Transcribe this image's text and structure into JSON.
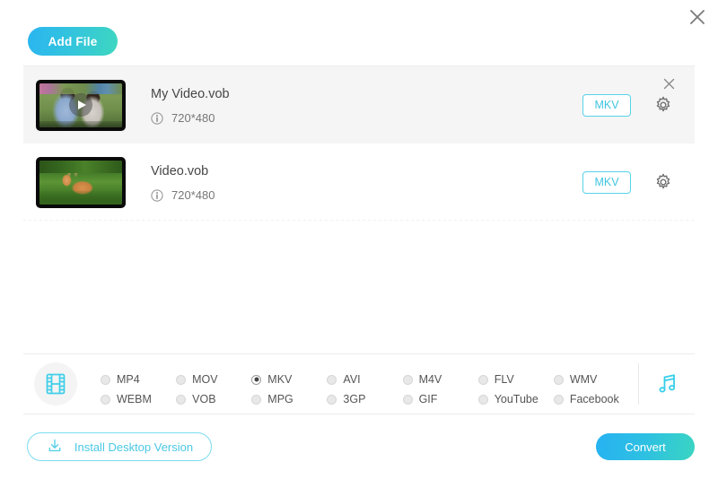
{
  "window": {
    "close_icon": "close-icon"
  },
  "toolbar": {
    "add_file_label": "Add File"
  },
  "files": [
    {
      "name": "My Video.vob",
      "resolution": "720*480",
      "format": "MKV",
      "selected": true,
      "has_play_overlay": true,
      "thumbnail": "two-people-on-grass",
      "info_icon": "info-icon",
      "settings_icon": "gear-icon",
      "remove_icon": "close-icon"
    },
    {
      "name": "Video.vob",
      "resolution": "720*480",
      "format": "MKV",
      "selected": false,
      "has_play_overlay": false,
      "thumbnail": "deer-in-grass",
      "info_icon": "info-icon",
      "settings_icon": "gear-icon"
    }
  ],
  "format_panel": {
    "video_icon": "film-strip-icon",
    "audio_icon": "music-note-icon",
    "selected_format": "MKV",
    "options": [
      {
        "label": "MP4",
        "checked": false
      },
      {
        "label": "MOV",
        "checked": false
      },
      {
        "label": "MKV",
        "checked": true
      },
      {
        "label": "AVI",
        "checked": false
      },
      {
        "label": "M4V",
        "checked": false
      },
      {
        "label": "FLV",
        "checked": false
      },
      {
        "label": "WMV",
        "checked": false
      },
      {
        "label": "WEBM",
        "checked": false
      },
      {
        "label": "VOB",
        "checked": false
      },
      {
        "label": "MPG",
        "checked": false
      },
      {
        "label": "3GP",
        "checked": false
      },
      {
        "label": "GIF",
        "checked": false
      },
      {
        "label": "YouTube",
        "checked": false
      },
      {
        "label": "Facebook",
        "checked": false
      }
    ]
  },
  "footer": {
    "install_label": "Install Desktop Version",
    "install_icon": "download-icon",
    "convert_label": "Convert"
  },
  "colors": {
    "accent_cyan": "#4ac8e4",
    "gradient_start": "#26b2f2",
    "gradient_end": "#3bd5c2",
    "row_selected_bg": "#f5f5f5"
  }
}
